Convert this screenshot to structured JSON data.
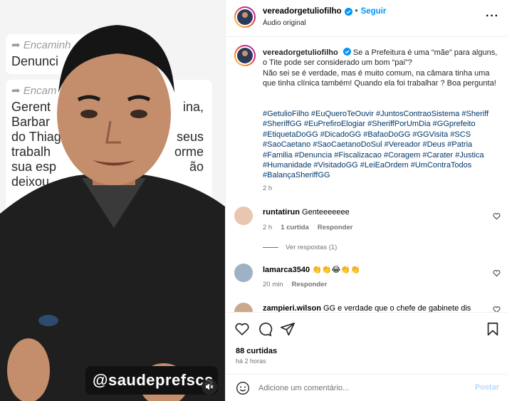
{
  "media": {
    "forward_label_1": "Encaminh",
    "text_1": "Denunci",
    "forward_label_2": "Encam",
    "bubble_lines_left": [
      "Gerent",
      "Barbar",
      "do Thiag",
      "trabalh",
      "sua esp",
      "deixou"
    ],
    "bubble_lines_right": [
      "ina,",
      "seus",
      "orme",
      "ão"
    ],
    "handle_tag": "@saudeprefscs"
  },
  "header": {
    "username": "vereadorgetuliofilho",
    "follow_label": "Seguir",
    "subtitle": "Áudio original"
  },
  "caption": {
    "username": "vereadorgetuliofilho",
    "text": "Se a Prefeitura é uma “mãe” para alguns, o Tite pode ser considerado um bom “pai”?\nNão sei se é verdade, mas é muito comum, na câmara tinha uma que tinha clínica também! Quando ela foi trabalhar ? Boa pergunta!",
    "hashtags": "#GetulioFilho #EuQueroTeOuvir #JuntosContraoSistema #Sheriff #SheriffGG #EuPrefiroElogiar #SheriffPorUmDia #GGprefeito #EtiquetaDoGG #DicadoGG #BafaoDoGG #GGVisita #SCS #SaoCaetano #SaoCaetanoDoSul #Vereador #Deus #Patria #Familia #Denuncia #Fiscalizacao #Coragem #Carater #Justica #Humanidade #VisitadoGG #LeiEaOrdem #UmContraTodos #BalançaSheriffGG",
    "time": "2 h"
  },
  "comments": [
    {
      "username": "runtatirun",
      "text": "Genteeeeeee",
      "time": "2 h",
      "likes": "1 curtida",
      "reply": "Responder",
      "view_replies": "Ver respostas (1)"
    },
    {
      "username": "lamarca3540",
      "text": "👏👏😂👏👏",
      "time": "20 min",
      "reply": "Responder"
    },
    {
      "username": "zampieri.wilson",
      "text": "GG e verdade que o chefe de gabinete dis"
    }
  ],
  "actions": {
    "likes_count": "88 curtidas",
    "post_time": "há 2 horas",
    "comment_placeholder": "Adicione um comentário...",
    "post_label": "Postar"
  },
  "colors": {
    "link_blue": "#0095f6",
    "hashtag_blue": "#00376b",
    "muted_text": "#737373",
    "post_disabled": "#b3dbff"
  }
}
